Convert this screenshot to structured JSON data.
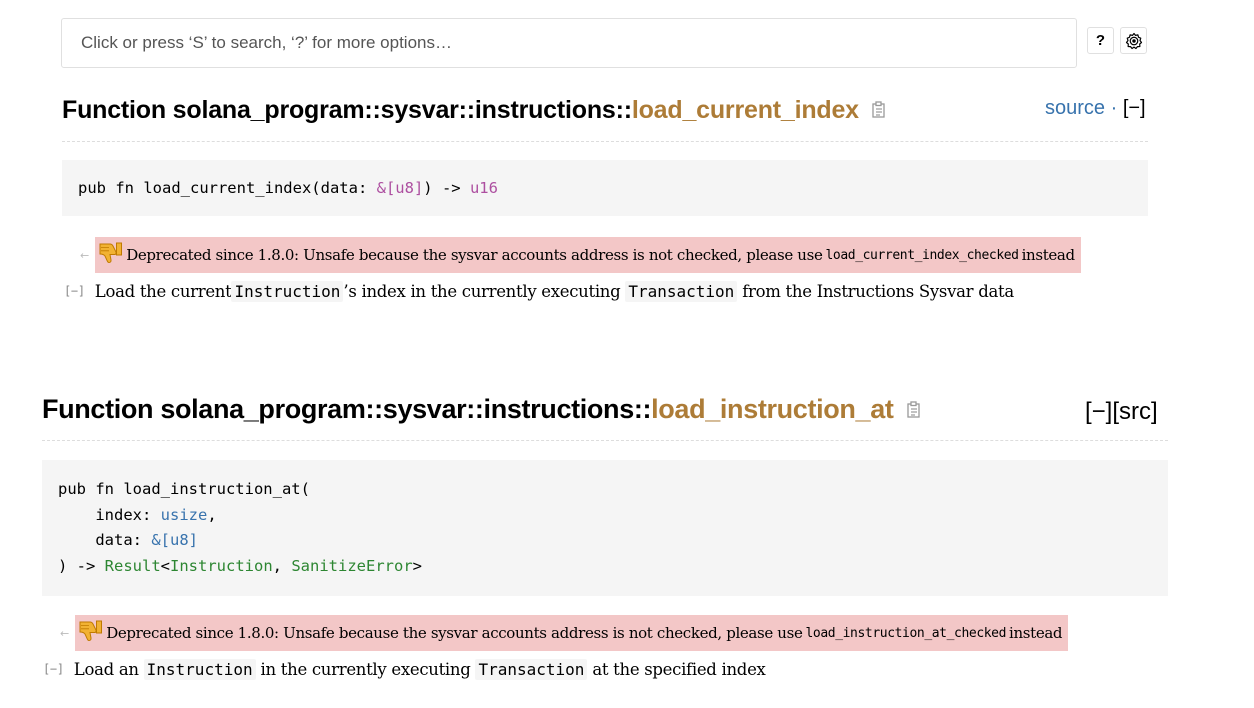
{
  "search": {
    "placeholder": "Click or press ‘S’ to search, ‘?’ for more options…",
    "help_label": "?",
    "settings_icon": "gear-icon"
  },
  "items": [
    {
      "title_prefix": "Function solana_program::sysvar::instructions::",
      "title_name": "load_current_index",
      "right": {
        "source": "source",
        "sep": " · ",
        "collapse": "[−]"
      },
      "code": {
        "line1_a": "pub fn load_current_index(data: ",
        "line1_type": "&[u8]",
        "line1_b": ") -> ",
        "line1_ret": "u16"
      },
      "deprecated": {
        "text_before": "Deprecated since 1.8.0: Unsafe because the sysvar accounts address is not checked, please use ",
        "code": "load_current_index_checked",
        "text_after": " instead"
      },
      "doc": {
        "toggle": "[−]",
        "t1": "Load the current ",
        "c1": "Instruction",
        "t2": "’s index in the currently executing ",
        "c2": "Transaction",
        "t3": " from the Instructions Sysvar data"
      }
    },
    {
      "title_prefix": "Function solana_program::sysvar::instructions::",
      "title_name": "load_instruction_at",
      "right": {
        "links": "[−][src]"
      },
      "code": {
        "l1": "pub fn load_instruction_at(",
        "l2_a": "    index: ",
        "l2_type": "usize",
        "l2_b": ",",
        "l3_a": "    data: ",
        "l3_type": "&[u8]",
        "l4_a": ") -> ",
        "l4_result": "Result",
        "l4_lt": "<",
        "l4_instr": "Instruction",
        "l4_comma": ", ",
        "l4_err": "SanitizeError",
        "l4_gt": ">"
      },
      "deprecated": {
        "text_before": "Deprecated since 1.8.0: Unsafe because the sysvar accounts address is not checked, please use ",
        "code": "load_instruction_at_checked",
        "text_after": " instead"
      },
      "doc": {
        "toggle": "[−]",
        "t1": "Load an ",
        "c1": "Instruction",
        "t2": " in the currently executing ",
        "c2": "Transaction",
        "t3": " at the specified index"
      }
    }
  ],
  "colors": {
    "function_name": "#ad7c37",
    "source_link": "#3873ad",
    "deprecated_bg": "#f3c7c7",
    "code_bg": "#f5f5f5"
  }
}
